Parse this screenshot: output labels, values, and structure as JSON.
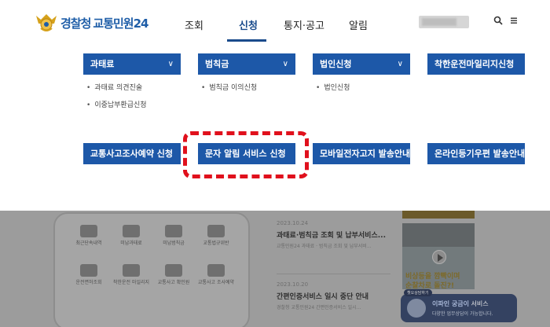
{
  "header": {
    "logo_police": "경찰청",
    "logo_service": "교통민원24",
    "nav": [
      {
        "label": "조회",
        "active": false
      },
      {
        "label": "신청",
        "active": true
      },
      {
        "label": "통지·공고",
        "active": false
      },
      {
        "label": "알림",
        "active": false
      }
    ],
    "icons": [
      "search-icon",
      "menu-icon"
    ]
  },
  "mega_menu": {
    "row1": [
      {
        "label": "과태료",
        "has_dropdown": true,
        "sub_items": [
          "과태료 의견진술",
          "이중납부환급신청"
        ]
      },
      {
        "label": "범칙금",
        "has_dropdown": true,
        "sub_items": [
          "범칙금 이의신청"
        ]
      },
      {
        "label": "법인신청",
        "has_dropdown": true,
        "sub_items": [
          "법인신청"
        ]
      },
      {
        "label": "착한운전마일리지신청",
        "has_dropdown": false,
        "sub_items": []
      }
    ],
    "row2": [
      {
        "label": "교통사고조사예약 신청"
      },
      {
        "label": "문자 알림 서비스 신청"
      },
      {
        "label": "모바일전자고지 발송안내"
      },
      {
        "label": "온라인등기우편 발송안내"
      }
    ],
    "highlight_color": "#e0101c"
  },
  "background": {
    "services": [
      [
        "최근단속내역",
        "미납과태료",
        "미납범칙금",
        "교통법규위반"
      ],
      [
        "운전면허조회",
        "착한운전 마일리지",
        "교통사고 확인원",
        "교통사고 조사예약"
      ]
    ],
    "news": [
      {
        "date": "2023.10.24",
        "title": "과태료·범칙금 조회 및 납부서비스...",
        "desc": "교통민원24 과태료 · 범칙금 조회 및 납부서비..."
      },
      {
        "date": "2023.10.20",
        "title": "간편인증서비스 일시 중단 안내",
        "desc": "경찰청 교통민원24 간편인증서비스 일시..."
      }
    ],
    "video": {
      "line1": "비상등을 깜빡이며",
      "line2": "순찰차로 돌진?!"
    },
    "chat": {
      "bubble": "챗오상담하기",
      "title_highlight": "이파인 궁금이",
      "title_rest": " 서비스",
      "subtitle": "다양한 업무상담이 가능합니다."
    }
  },
  "colors": {
    "primary": "#1d58a8",
    "nav_active": "#1a4b8c",
    "highlight": "#e0101c"
  }
}
